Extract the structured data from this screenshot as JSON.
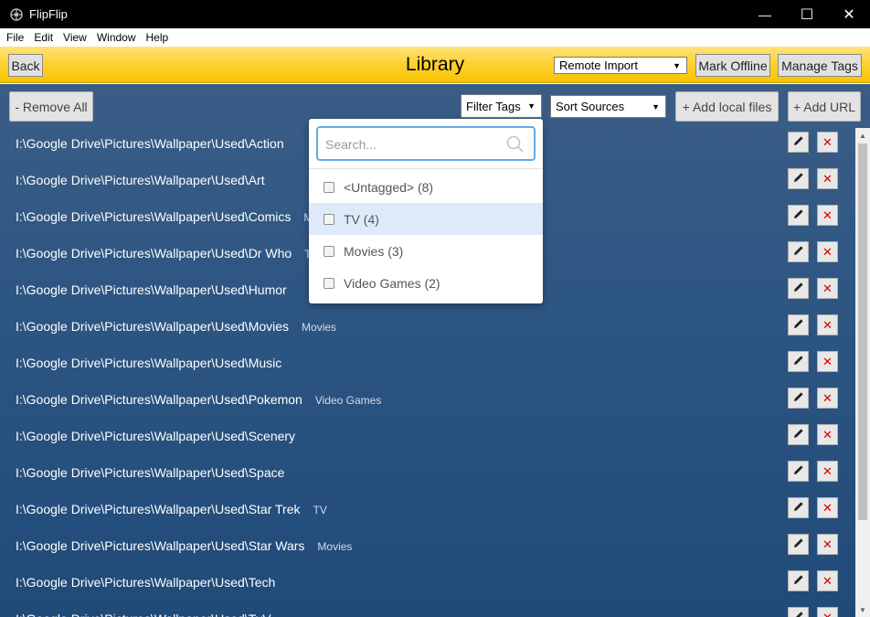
{
  "window": {
    "title": "FlipFlip",
    "minimize_glyph": "—",
    "maximize_glyph": "☐",
    "close_glyph": "✕"
  },
  "menu": [
    "File",
    "Edit",
    "View",
    "Window",
    "Help"
  ],
  "header": {
    "back_label": "Back",
    "title": "Library",
    "import_select": "Remote Import",
    "mark_offline_label": "Mark Offline",
    "manage_tags_label": "Manage Tags",
    "accent_color": "#ffd233"
  },
  "toolbar": {
    "remove_all_label": "- Remove All",
    "filter_tags_label": "Filter Tags",
    "sort_sources_label": "Sort Sources",
    "add_local_files_label": "+ Add local files",
    "add_url_label": "+ Add URL"
  },
  "filter_dropdown": {
    "search_placeholder": "Search...",
    "options": [
      {
        "label": "<Untagged> (8)",
        "checked": false
      },
      {
        "label": "TV (4)",
        "checked": false,
        "highlighted": true
      },
      {
        "label": "Movies (3)",
        "checked": false
      },
      {
        "label": "Video Games (2)",
        "checked": false
      }
    ]
  },
  "sources": [
    {
      "path": "I:\\Google Drive\\Pictures\\Wallpaper\\Used\\Action",
      "tags": ""
    },
    {
      "path": "I:\\Google Drive\\Pictures\\Wallpaper\\Used\\Art",
      "tags": ""
    },
    {
      "path": "I:\\Google Drive\\Pictures\\Wallpaper\\Used\\Comics",
      "tags": "M"
    },
    {
      "path": "I:\\Google Drive\\Pictures\\Wallpaper\\Used\\Dr Who",
      "tags": "T"
    },
    {
      "path": "I:\\Google Drive\\Pictures\\Wallpaper\\Used\\Humor",
      "tags": ""
    },
    {
      "path": "I:\\Google Drive\\Pictures\\Wallpaper\\Used\\Movies",
      "tags": "Movies"
    },
    {
      "path": "I:\\Google Drive\\Pictures\\Wallpaper\\Used\\Music",
      "tags": ""
    },
    {
      "path": "I:\\Google Drive\\Pictures\\Wallpaper\\Used\\Pokemon",
      "tags": "Video Games"
    },
    {
      "path": "I:\\Google Drive\\Pictures\\Wallpaper\\Used\\Scenery",
      "tags": ""
    },
    {
      "path": "I:\\Google Drive\\Pictures\\Wallpaper\\Used\\Space",
      "tags": ""
    },
    {
      "path": "I:\\Google Drive\\Pictures\\Wallpaper\\Used\\Star Trek",
      "tags": "TV"
    },
    {
      "path": "I:\\Google Drive\\Pictures\\Wallpaper\\Used\\Star Wars",
      "tags": "Movies"
    },
    {
      "path": "I:\\Google Drive\\Pictures\\Wallpaper\\Used\\Tech",
      "tags": ""
    },
    {
      "path": "I:\\Google Drive\\Pictures\\Wallpaper\\Used\\TvV...",
      "tags": ""
    }
  ],
  "row_actions": {
    "edit_icon": "pencil-icon",
    "delete_icon": "close-icon",
    "delete_glyph": "✕",
    "delete_color": "#d40000"
  },
  "scrollbar": {
    "up_glyph": "▲",
    "down_glyph": "▼"
  },
  "select_arrow": "▼"
}
